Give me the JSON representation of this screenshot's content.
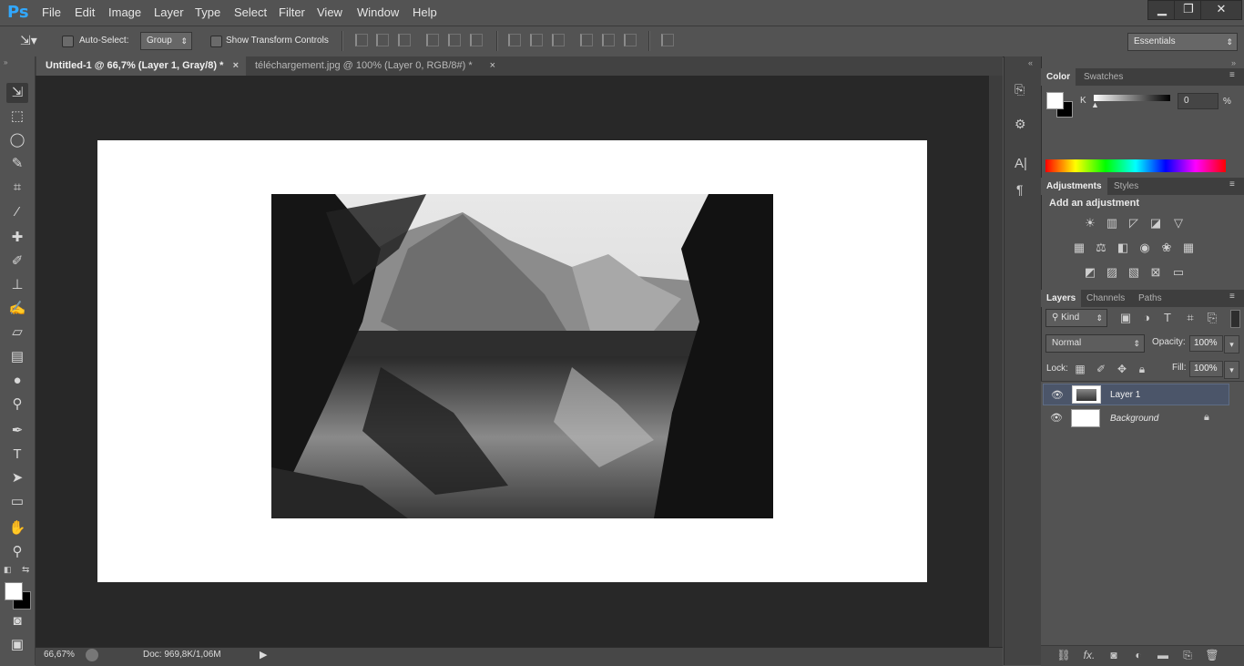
{
  "app": {
    "logo": "Ps"
  },
  "menu": [
    "File",
    "Edit",
    "Image",
    "Layer",
    "Type",
    "Select",
    "Filter",
    "View",
    "Window",
    "Help"
  ],
  "window_controls": {
    "minimize": "▁",
    "restore": "❐",
    "close": "✕"
  },
  "options": {
    "auto_select_label": "Auto-Select:",
    "auto_select_value": "Group",
    "transform_label": "Show Transform Controls",
    "workspace": "Essentials"
  },
  "tabs": [
    {
      "label": "Untitled-1 @ 66,7% (Layer 1, Gray/8) *",
      "close": "×"
    },
    {
      "label": "téléchargement.jpg @ 100% (Layer 0, RGB/8#) *",
      "close": "×"
    }
  ],
  "status": {
    "zoom": "66,67%",
    "doc": "Doc: 969,8K/1,06M",
    "arrow": "▶"
  },
  "color_panel": {
    "tabs": [
      "Color",
      "Swatches"
    ],
    "channel": "K",
    "value": "0",
    "unit": "%"
  },
  "adjustments_panel": {
    "tabs": [
      "Adjustments",
      "Styles"
    ],
    "heading": "Add an adjustment"
  },
  "layers_panel": {
    "tabs": [
      "Layers",
      "Channels",
      "Paths"
    ],
    "filter": "Kind",
    "blend_mode": "Normal",
    "opacity_label": "Opacity:",
    "opacity": "100%",
    "lock_label": "Lock:",
    "fill_label": "Fill:",
    "fill": "100%",
    "layers": [
      {
        "name": "Layer 1",
        "visible": true,
        "selected": true
      },
      {
        "name": "Background",
        "visible": true,
        "locked": true
      }
    ],
    "bottom_icons": [
      "link-icon",
      "fx-icon",
      "mask-icon",
      "adjustment-icon",
      "group-icon",
      "new-layer-icon",
      "trash-icon"
    ]
  },
  "colors": {
    "accent": "#31a8ff",
    "panel_bg": "#535353",
    "workspace_bg": "#282828",
    "selected_layer": "#4b5569"
  }
}
